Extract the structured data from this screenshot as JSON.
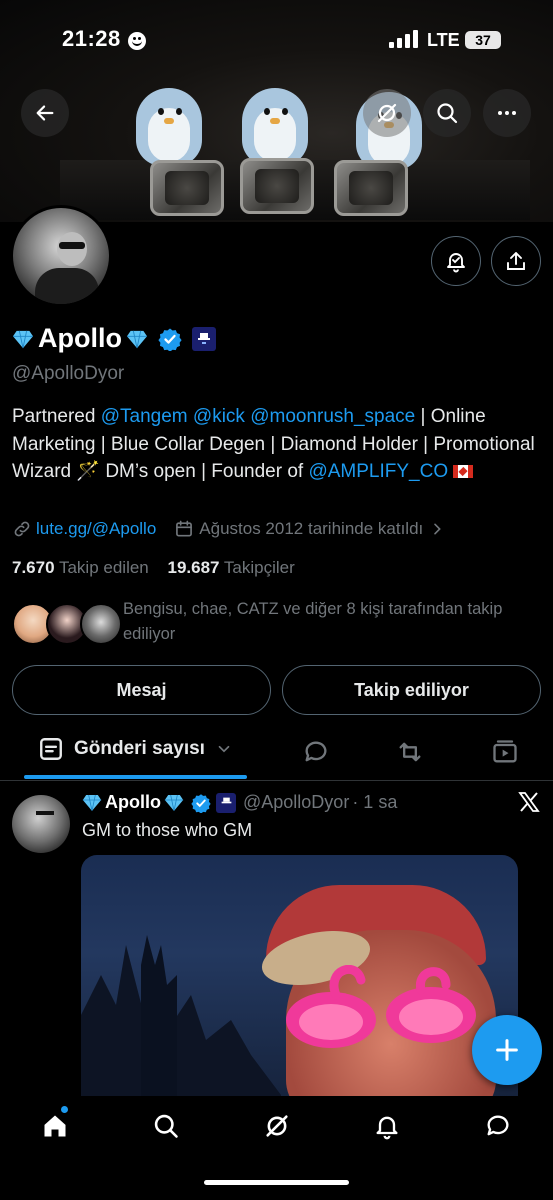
{
  "status_bar": {
    "time": "21:28",
    "network": "LTE",
    "battery": "37"
  },
  "profile": {
    "display_name": "Apollo",
    "handle": "@ApolloDyor",
    "bio": {
      "pre": "Partnered ",
      "link1": "@Tangem",
      "link2": "@kick",
      "link3": "@moonrush_space",
      "mid": " | Online Marketing | Blue Collar Degen | Diamond Holder | Promotional Wizard 🪄 DM’s open | Founder of ",
      "link4": "@AMPLIFY_CO"
    },
    "website": "lute.gg/@Apollo",
    "joined": "Ağustos 2012 tarihinde katıldı",
    "following_count": "7.670",
    "following_label": "Takip edilen",
    "followers_count": "19.687",
    "followers_label": "Takipçiler",
    "mutuals_text": "Bengisu, chae, CATZ ve diğer 8 kişi tarafından takip ediliyor"
  },
  "actions": {
    "message": "Mesaj",
    "following": "Takip ediliyor"
  },
  "tabs": {
    "active_label": "Gönderi sayısı"
  },
  "post": {
    "name": "Apollo",
    "handle": "@ApolloDyor",
    "time": "· 1 sa",
    "text": "GM to those who GM"
  },
  "icons": {
    "back": "arrow-left-icon",
    "grok": "grok-icon",
    "search": "search-icon",
    "more": "more-icon",
    "notify": "bell-check-icon",
    "share": "share-icon",
    "verified": "verified-badge-icon",
    "affiliate": "affiliate-badge-icon",
    "link": "link-icon",
    "calendar": "calendar-icon",
    "fab": "plus-icon",
    "nav": [
      "home-icon",
      "search-icon",
      "grok-icon",
      "bell-icon",
      "messages-icon"
    ]
  },
  "colors": {
    "accent": "#1d9bf0",
    "background": "#000000",
    "muted": "#71767b"
  }
}
